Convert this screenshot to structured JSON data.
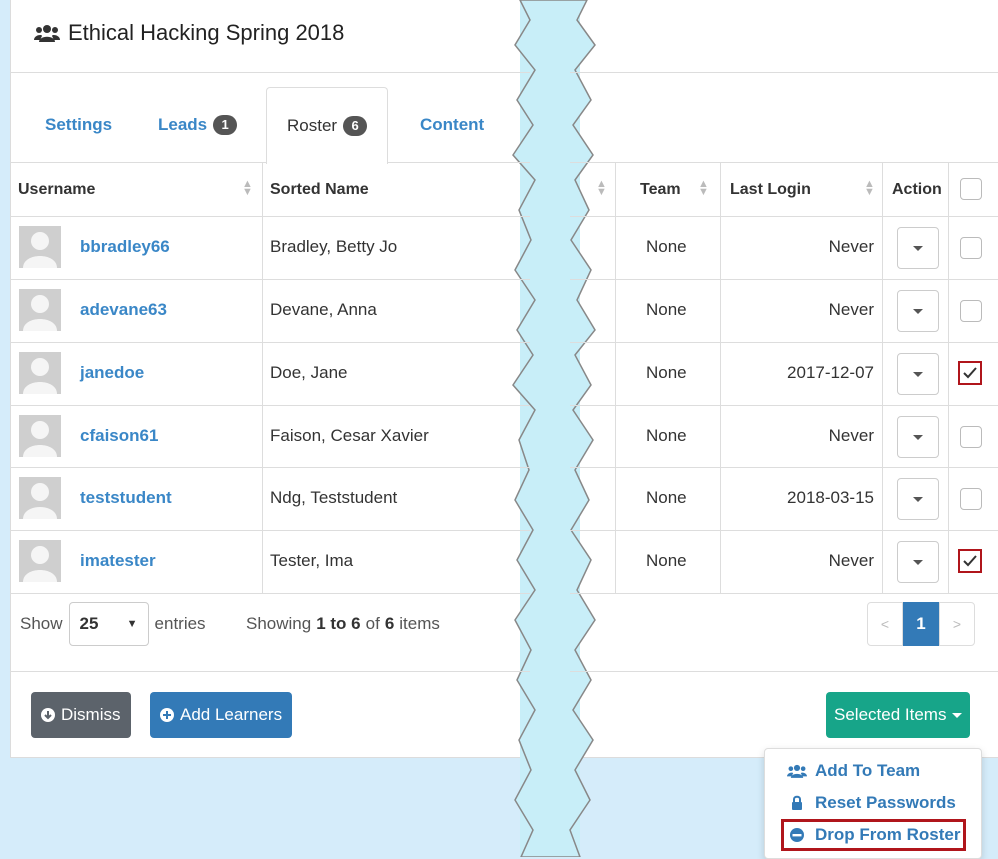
{
  "title": "Ethical Hacking Spring 2018",
  "tabs": [
    {
      "label": "Settings"
    },
    {
      "label": "Leads",
      "badge": "1"
    },
    {
      "label": "Roster",
      "badge": "6"
    },
    {
      "label": "Content"
    }
  ],
  "columns": {
    "username": "Username",
    "sorted_name": "Sorted Name",
    "team": "Team",
    "last_login": "Last Login",
    "action": "Action"
  },
  "rows": [
    {
      "username": "bbradley66",
      "sorted_name": "Bradley, Betty Jo",
      "team": "None",
      "last_login": "Never",
      "checked": false
    },
    {
      "username": "adevane63",
      "sorted_name": "Devane, Anna",
      "team": "None",
      "last_login": "Never",
      "checked": false
    },
    {
      "username": "janedoe",
      "sorted_name": "Doe, Jane",
      "team": "None",
      "last_login": "2017-12-07",
      "checked": true
    },
    {
      "username": "cfaison61",
      "sorted_name": "Faison, Cesar Xavier",
      "team": "None",
      "last_login": "Never",
      "checked": false
    },
    {
      "username": "teststudent",
      "sorted_name": "Ndg, Teststudent",
      "team": "None",
      "last_login": "2018-03-15",
      "checked": false
    },
    {
      "username": "imatester",
      "sorted_name": "Tester, Ima",
      "team": "None",
      "last_login": "Never",
      "checked": true
    }
  ],
  "footer": {
    "show_label": "Show",
    "page_size": "25",
    "entries_label": "entries",
    "showing_prefix": "Showing",
    "range": "1 to 6",
    "of_label": "of",
    "total": "6",
    "items_label": "items",
    "current_page": "1",
    "prev": "<",
    "next": ">"
  },
  "buttons": {
    "dismiss": "Dismiss",
    "add_learners": "Add Learners",
    "selected_items": "Selected Items"
  },
  "menu": {
    "add_to_team": "Add To Team",
    "reset_passwords": "Reset Passwords",
    "drop_from_roster": "Drop From Roster"
  },
  "colors": {
    "link": "#3a87c7",
    "primary": "#337ab7",
    "success": "#17a589",
    "highlight": "#b0151b"
  }
}
